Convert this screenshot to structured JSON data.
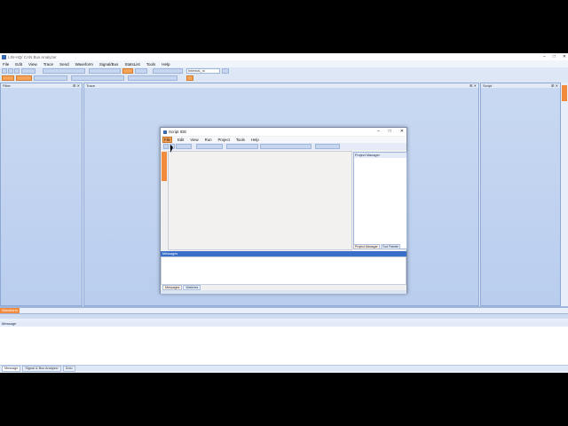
{
  "app": {
    "title": "LIN-HQ/ CAN Bus Analyzer",
    "window_controls": [
      "–",
      "□",
      "✕"
    ]
  },
  "menubar": [
    "File",
    "Edit",
    "View",
    "Trace",
    "Send",
    "Waveform",
    "Signal/Bus",
    "StatsList",
    "Tools",
    "Help"
  ],
  "toolbar": {
    "interface_value": "Internal_ni"
  },
  "panels": {
    "filter": "Filter",
    "trace": "Trace",
    "script": "Script",
    "message": "Message"
  },
  "waveform_tab": "Waveform",
  "bottom_tabs": [
    "Message",
    "Signal & Bus Analyzer",
    "Dolo"
  ],
  "ide": {
    "title": "Script IDE",
    "window_controls": [
      "–",
      "□",
      "✕"
    ],
    "menu": [
      "File",
      "Edit",
      "View",
      "Run",
      "Project",
      "Tools",
      "Help"
    ],
    "project_manager": "Project Manager",
    "pm_tabs": [
      "Project Manager",
      "Tool Palette"
    ],
    "messages_head": "Messages",
    "bottom_tabs": [
      "Messages",
      "Watches"
    ]
  },
  "colors": {
    "accent": "#f28b3c",
    "panel": "#c9d9f2",
    "header_blue": "#3a6fc9"
  }
}
